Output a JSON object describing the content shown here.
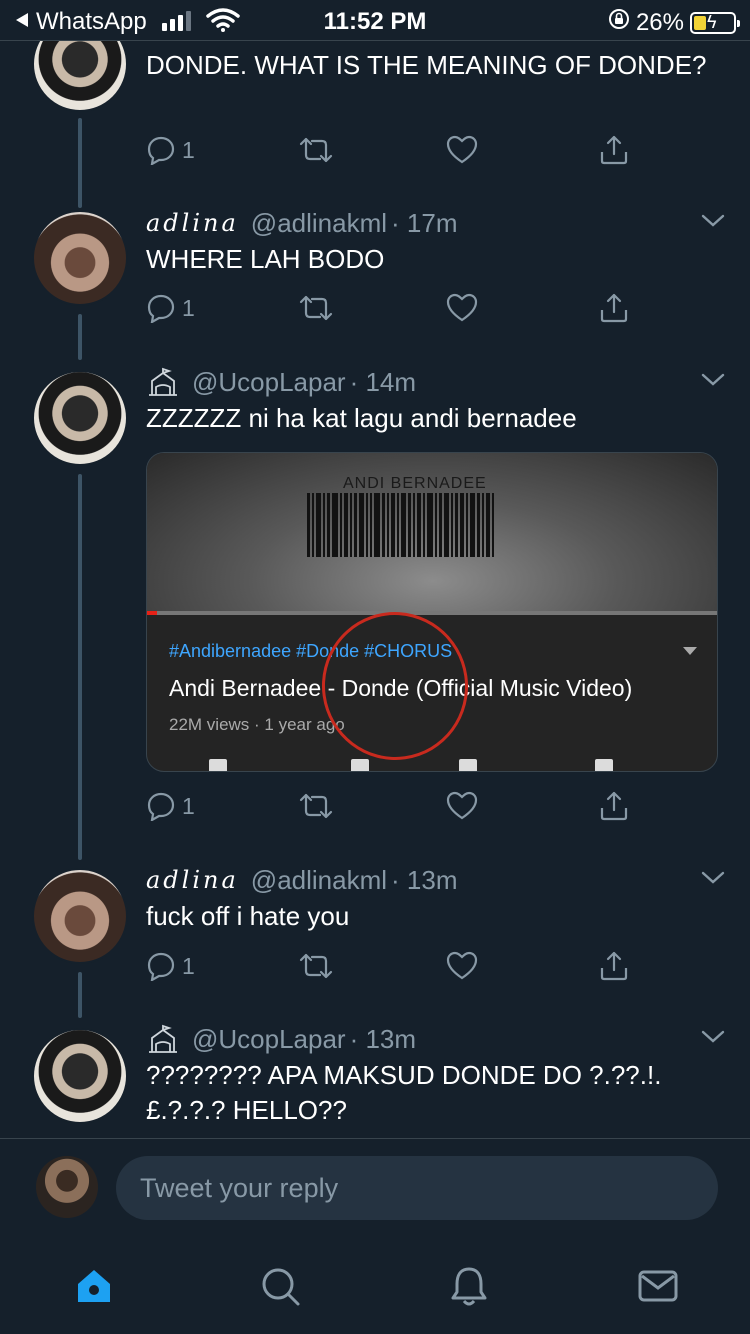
{
  "status_bar": {
    "back_app": "WhatsApp",
    "time": "11:52 PM",
    "battery": "26%"
  },
  "tweets": [
    {
      "text": "DONDE. WHAT IS THE MEANING OF DONDE?",
      "reply_count": "1"
    },
    {
      "display_name": "adlina",
      "handle": "@adlinakml",
      "age": "· 17m",
      "text": "WHERE LAH BODO",
      "reply_count": "1"
    },
    {
      "handle": "@UcopLapar",
      "age": "· 14m",
      "text": "ZZZZZZ ni ha kat lagu andi bernadee",
      "reply_count": "1",
      "card": {
        "thumb_label": "ANDI  BERNADEE",
        "tags": "#Andibernadee #Donde #CHORUS",
        "title": "Andi Bernadee - Donde (Official Music Video)",
        "meta": "22M views · 1 year ago"
      }
    },
    {
      "display_name": "adlina",
      "handle": "@adlinakml",
      "age": "· 13m",
      "text": "fuck off i hate you",
      "reply_count": "1"
    },
    {
      "handle": "@UcopLapar",
      "age": "· 13m",
      "text": "???????? APA MAKSUD DONDE DO ?.??.!. £.?.?.? HELLO??"
    }
  ],
  "reply": {
    "placeholder": "Tweet your reply"
  },
  "tabbar": {
    "icons": [
      "home-icon",
      "search-icon",
      "notifications-icon",
      "messages-icon"
    ],
    "active_color": "#1da1f2"
  },
  "colors": {
    "background": "#15202b",
    "muted": "#8899a6",
    "thread_line": "#3d5466",
    "annotation": "#c82a1e"
  }
}
